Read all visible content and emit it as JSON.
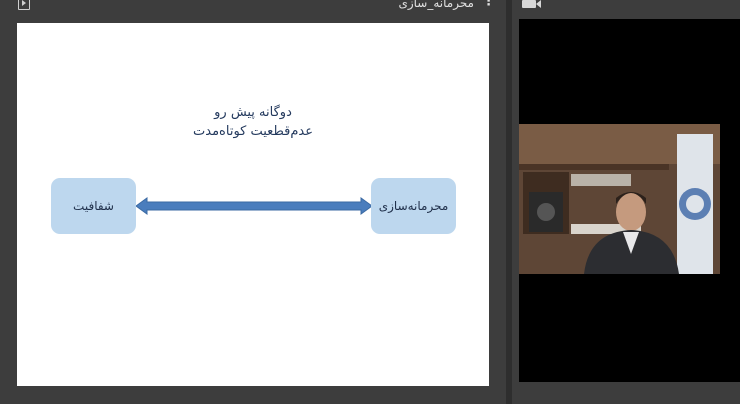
{
  "presentation_panel": {
    "title": "محرمانه_سازی"
  },
  "slide": {
    "heading_line1": "دوگانه پیش رو",
    "heading_line2": "عدم‌قطعیت کوتاه‌مدت",
    "left_box_label": "شفافیت",
    "right_box_label": "محرمانه‌سازی"
  },
  "colors": {
    "box_fill": "#bdd7ee",
    "arrow_fill": "#4a7dbd",
    "heading_text": "#243a5e"
  },
  "icons": {
    "presentation_panel": "slideshow-icon",
    "more": "more-vertical-icon",
    "video_panel": "video-camera-icon"
  }
}
